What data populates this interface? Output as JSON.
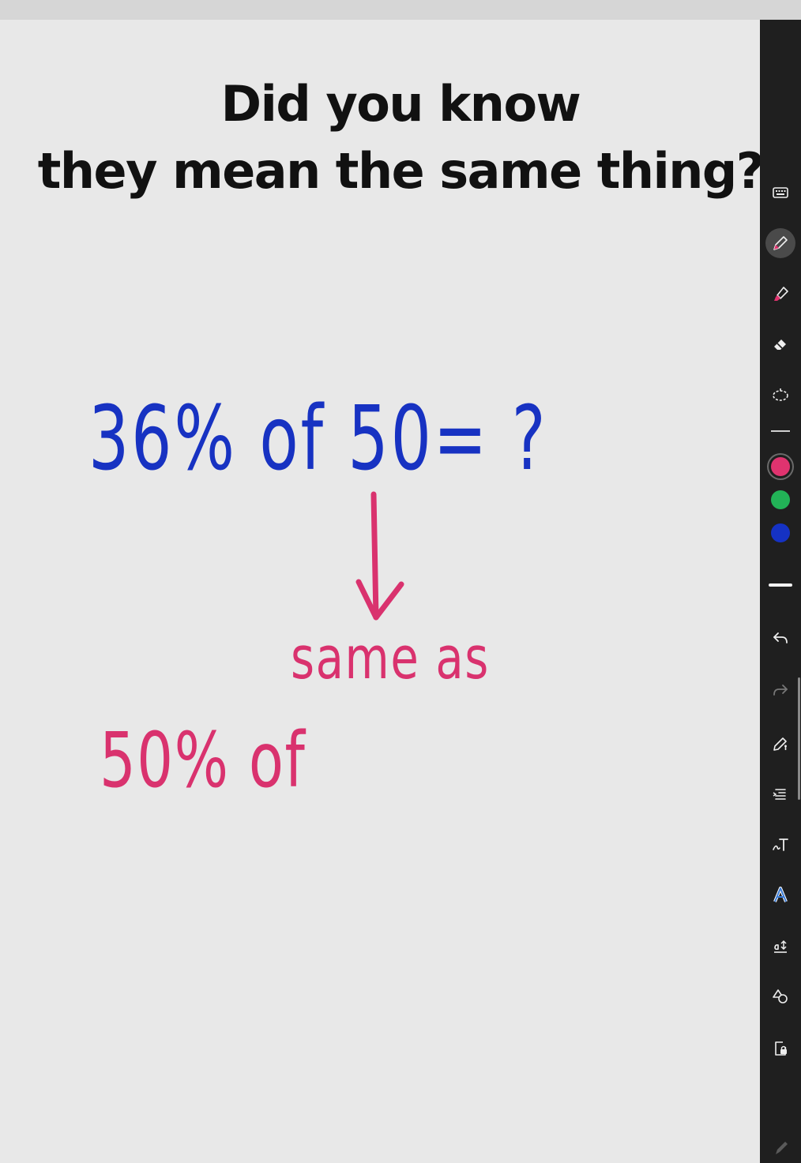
{
  "canvas": {
    "title_line1": "Did you know",
    "title_line2": "they mean the same thing?",
    "handwriting": {
      "equation": "36% of 50= ?",
      "connector": "same as",
      "second": "50% of"
    },
    "ink_colors": {
      "blue": "#1732c2",
      "pink": "#d9326e"
    }
  },
  "toolbar": {
    "tools": [
      "keyboard-icon",
      "pen-icon",
      "highlighter-icon",
      "eraser-icon",
      "lasso-icon"
    ],
    "active_tool": "pen-icon",
    "colors": [
      "#e0336f",
      "#22b357",
      "#1532c4"
    ],
    "selected_color": "#e0336f",
    "actions": [
      "undo-icon",
      "redo-icon",
      "pencil-settings-icon",
      "text-list-icon",
      "handwriting-text-icon",
      "font-style-icon",
      "text-size-icon",
      "shapes-icon",
      "lock-page-icon"
    ]
  }
}
